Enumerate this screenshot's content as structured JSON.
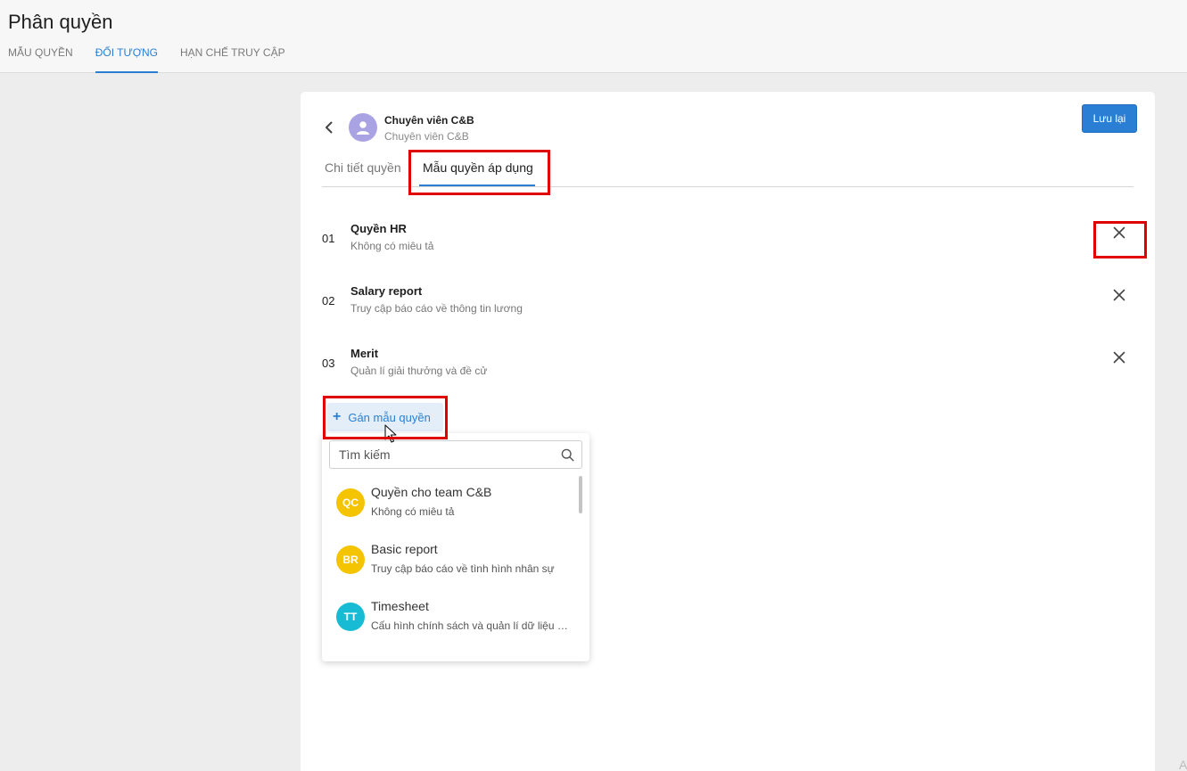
{
  "header": {
    "title": "Phân quyền",
    "tabs": [
      {
        "label": "MẪU QUYỀN"
      },
      {
        "label": "ĐỐI TƯỢNG"
      },
      {
        "label": "HẠN CHẾ TRUY CẬP"
      }
    ],
    "active_tab": "ĐỐI TƯỢNG"
  },
  "object": {
    "name": "Chuyên viên C&B",
    "subtitle": "Chuyên viên C&B",
    "save_label": "Lưu lại"
  },
  "sub_tabs": [
    {
      "label": "Chi tiết quyền"
    },
    {
      "label": "Mẫu quyền áp dụng"
    }
  ],
  "active_sub_tab": "Mẫu quyền áp dụng",
  "permissions": [
    {
      "index": "01",
      "name": "Quyền HR",
      "description": "Không có miêu tả"
    },
    {
      "index": "02",
      "name": "Salary report",
      "description": "Truy cập báo cáo về thông tin lương"
    },
    {
      "index": "03",
      "name": "Merit",
      "description": "Quản lí giải thưởng và đề cử"
    }
  ],
  "assign_button": {
    "icon": "+",
    "label": "Gán mẫu quyền"
  },
  "dropdown": {
    "search_placeholder": "Tìm kiếm",
    "items": [
      {
        "initials": "QC",
        "name": "Quyền cho team C&B",
        "description": "Không có miêu tả",
        "color": "#f5c400"
      },
      {
        "initials": "BR",
        "name": "Basic report",
        "description": "Truy cập báo cáo về tình hình nhân sự",
        "color": "#f5c400"
      },
      {
        "initials": "TT",
        "name": "Timesheet",
        "description": "Cấu hình chính sách và quản lí dữ liệu nhân sự",
        "color": "#17bcd4"
      }
    ]
  },
  "corner_mark": "A",
  "colors": {
    "accent": "#2a7fd4",
    "highlight_box": "#e00000"
  }
}
